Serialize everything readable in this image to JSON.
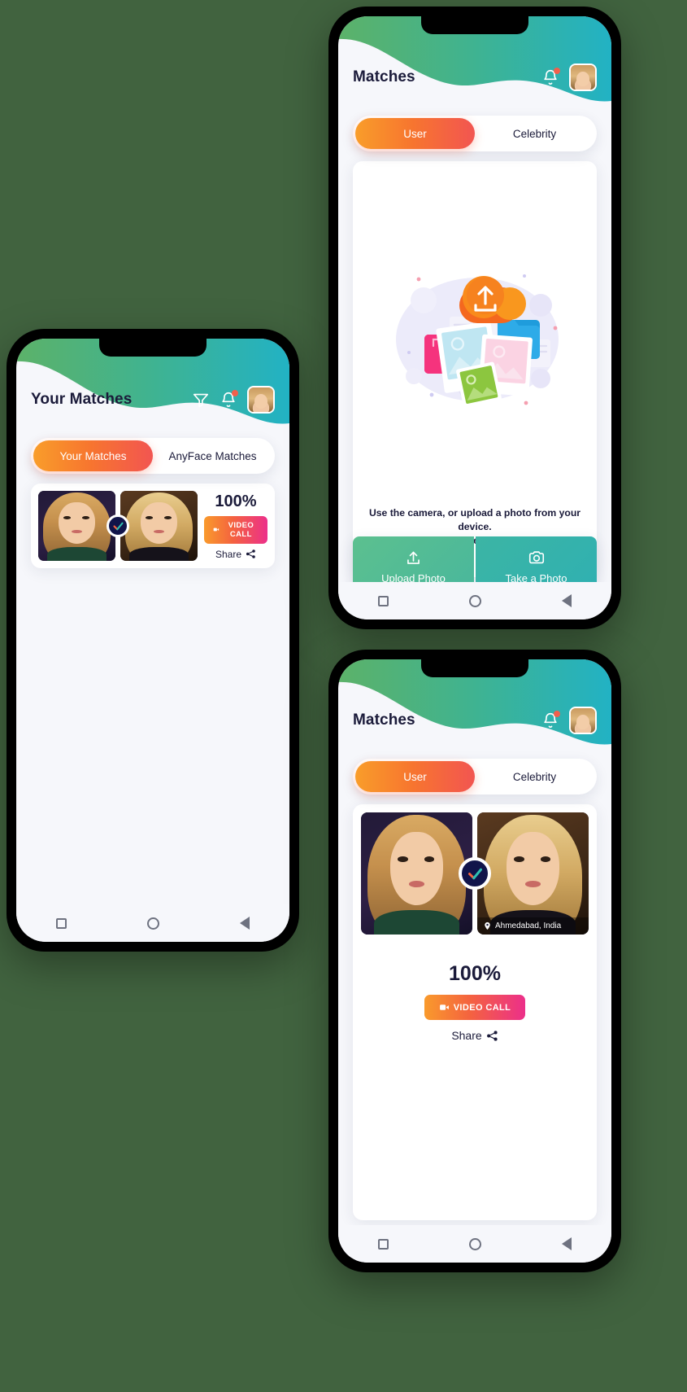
{
  "background_color": "#41633f",
  "theme": {
    "accent_orange": "#f7752f",
    "accent_pink": "#ec2f8a",
    "teal": "#2fb0b2",
    "green": "#5cc08f",
    "navy": "#1b1b3a",
    "screen_bg": "#f6f7fb"
  },
  "phones": {
    "left": {
      "header": {
        "title": "Your Matches",
        "icons": [
          "filter-icon",
          "bell-icon",
          "avatar"
        ],
        "bell_has_badge": true
      },
      "tabs": [
        {
          "label": "Your Matches",
          "active": true
        },
        {
          "label": "AnyFace Matches",
          "active": false
        }
      ],
      "match": {
        "percent": "100%",
        "video_call_label": "VIDEO CALL",
        "share_label": "Share",
        "verified": true
      },
      "navbar": [
        "square-icon",
        "circle-icon",
        "back-triangle-icon"
      ]
    },
    "top": {
      "header": {
        "title": "Matches",
        "icons": [
          "bell-icon",
          "avatar"
        ],
        "bell_has_badge": true
      },
      "tabs": [
        {
          "label": "User",
          "active": true
        },
        {
          "label": "Celebrity",
          "active": false
        }
      ],
      "upload": {
        "line1": "Use the camera, or upload a photo from your device.",
        "line2": "We will sprinkle some of our binary magic powder on your photo to find your matches !",
        "upload_button": "Upload Photo",
        "camera_button": "Take a Photo"
      },
      "navbar": [
        "square-icon",
        "circle-icon",
        "back-triangle-icon"
      ]
    },
    "bottom": {
      "header": {
        "title": "Matches",
        "icons": [
          "bell-icon",
          "avatar"
        ],
        "bell_has_badge": true
      },
      "tabs": [
        {
          "label": "User",
          "active": true
        },
        {
          "label": "Celebrity",
          "active": false
        }
      ],
      "match": {
        "percent": "100%",
        "video_call_label": "VIDEO CALL",
        "share_label": "Share",
        "location": "Ahmedabad, India",
        "verified": true
      },
      "navbar": [
        "square-icon",
        "circle-icon",
        "back-triangle-icon"
      ]
    }
  }
}
